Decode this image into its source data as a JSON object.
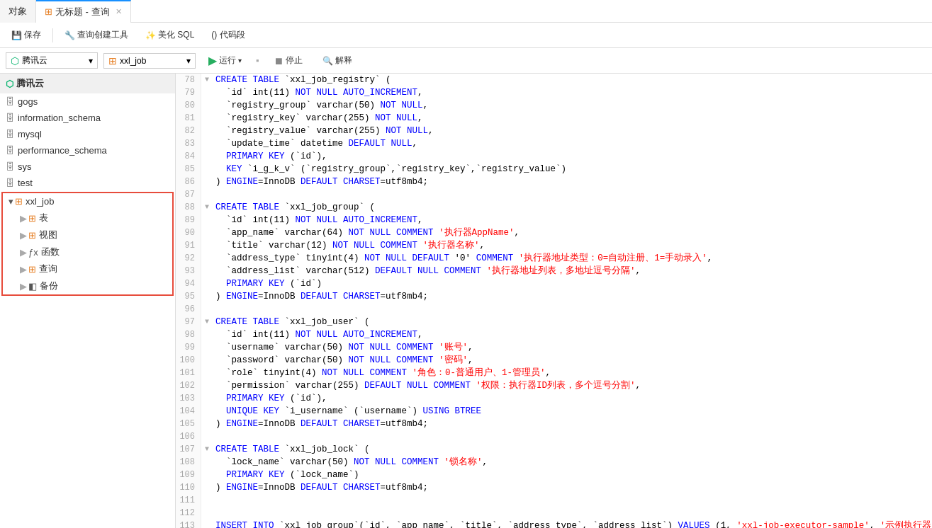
{
  "app": {
    "title": "腾讯云",
    "tab_label": "无标题 - 查询"
  },
  "toolbar": {
    "save": "保存",
    "query_create_tool": "查询创建工具",
    "beautify_sql": "美化 SQL",
    "code_segment": "() 代码段",
    "run": "运行",
    "stop": "停止",
    "explain": "解释"
  },
  "sidebar": {
    "databases": [
      {
        "name": "gogs",
        "icon": "db"
      },
      {
        "name": "information_schema",
        "icon": "db"
      },
      {
        "name": "mysql",
        "icon": "db"
      },
      {
        "name": "performance_schema",
        "icon": "db"
      },
      {
        "name": "sys",
        "icon": "db"
      },
      {
        "name": "test",
        "icon": "db"
      },
      {
        "name": "xxl_job",
        "icon": "db",
        "selected": true,
        "expanded": true
      }
    ],
    "xxl_job_children": [
      {
        "name": "表",
        "icon": "table"
      },
      {
        "name": "视图",
        "icon": "view"
      },
      {
        "name": "函数",
        "icon": "func"
      },
      {
        "name": "查询",
        "icon": "query"
      },
      {
        "name": "备份",
        "icon": "backup"
      }
    ]
  },
  "selected_db": "腾讯云",
  "selected_schema": "xxl_job"
}
